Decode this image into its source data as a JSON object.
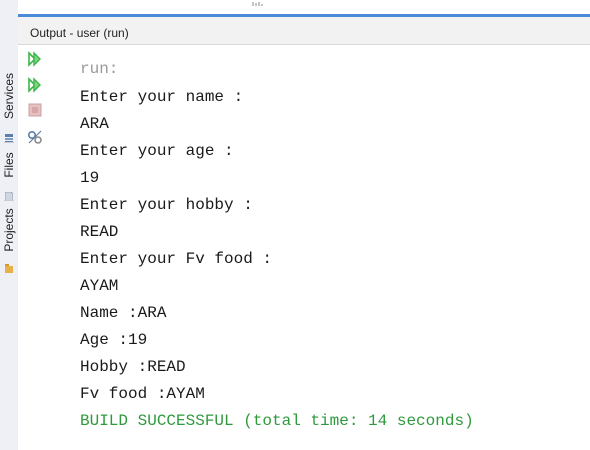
{
  "panel": {
    "title": "Output - user (run)"
  },
  "sidebar": {
    "tabs": [
      {
        "label": "Projects"
      },
      {
        "label": "Files"
      },
      {
        "label": "Services"
      }
    ]
  },
  "toolbar": {
    "buttons": [
      {
        "icon": "rerun-icon",
        "color": "#3bb54a"
      },
      {
        "icon": "rerun-with-options-icon",
        "color": "#3bb54a"
      },
      {
        "icon": "stop-icon",
        "color": "#d08a8a"
      },
      {
        "icon": "settings-icon",
        "color": "#5b7fa8"
      }
    ]
  },
  "console": {
    "lines": [
      {
        "text": "run:",
        "style": "dim"
      },
      {
        "text": "Enter your name :",
        "style": "normal"
      },
      {
        "text": "ARA",
        "style": "normal"
      },
      {
        "text": "Enter your age :",
        "style": "normal"
      },
      {
        "text": "19",
        "style": "normal"
      },
      {
        "text": "Enter your hobby :",
        "style": "normal"
      },
      {
        "text": "READ",
        "style": "normal"
      },
      {
        "text": "Enter your Fv food :",
        "style": "normal"
      },
      {
        "text": "AYAM",
        "style": "normal"
      },
      {
        "text": "Name :ARA",
        "style": "normal"
      },
      {
        "text": "Age :19",
        "style": "normal"
      },
      {
        "text": "Hobby :READ",
        "style": "normal"
      },
      {
        "text": "Fv food :AYAM",
        "style": "normal"
      },
      {
        "text": "BUILD SUCCESSFUL (total time: 14 seconds)",
        "style": "success"
      }
    ]
  },
  "colors": {
    "success": "#2e9a3c",
    "dim": "#9a9a9a",
    "accent": "#4a8ad8"
  }
}
